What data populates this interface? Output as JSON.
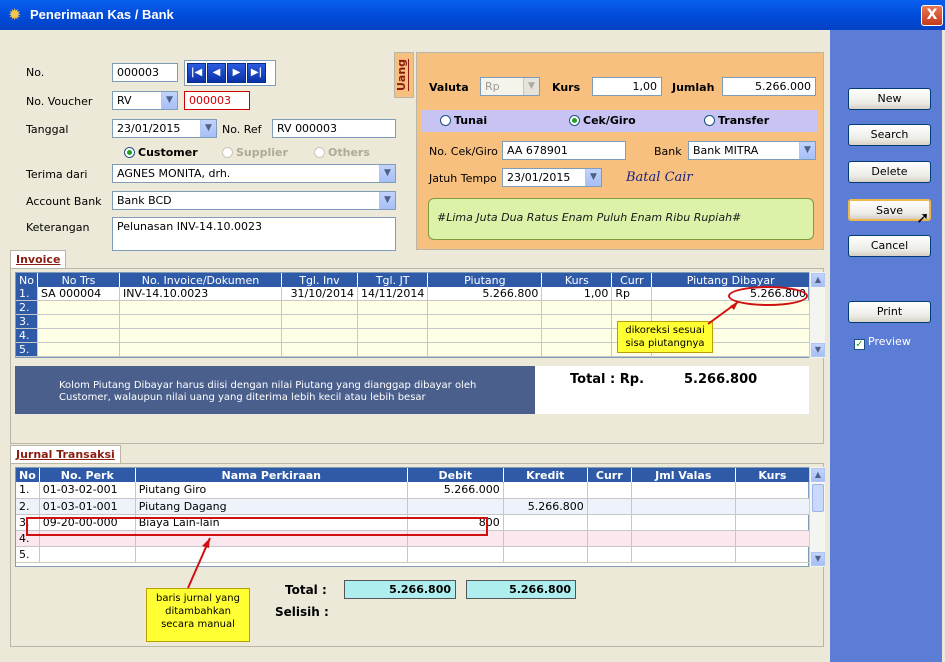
{
  "window": {
    "title": "Penerimaan Kas / Bank",
    "close_glyph": "X"
  },
  "form": {
    "no_label": "No.",
    "no_value": "000003",
    "voucher_label": "No. Voucher",
    "voucher_type": "RV",
    "voucher_no": "000003",
    "tanggal_label": "Tanggal",
    "tanggal_value": "23/01/2015",
    "noref_label": "No. Ref",
    "noref_value": "RV 000003",
    "radio_customer": "Customer",
    "radio_supplier": "Supplier",
    "radio_others": "Others",
    "terima_label": "Terima dari",
    "terima_value": "AGNES MONITA, drh.",
    "account_label": "Account Bank",
    "account_value": "Bank BCD",
    "ket_label": "Keterangan",
    "ket_value": "Pelunasan INV-14.10.0023"
  },
  "uang": {
    "tab": "Uang",
    "valuta_label": "Valuta",
    "valuta_value": "Rp",
    "kurs_label": "Kurs",
    "kurs_value": "1,00",
    "jumlah_label": "Jumlah",
    "jumlah_value": "5.266.000",
    "tunai": "Tunai",
    "cekgiro": "Cek/Giro",
    "transfer": "Transfer",
    "nocek_label": "No. Cek/Giro",
    "nocek_value": "AA 678901",
    "bank_label": "Bank",
    "bank_value": "Bank MITRA",
    "jatuh_label": "Jatuh Tempo",
    "jatuh_value": "23/01/2015",
    "batal": "Batal Cair",
    "terbilang": "#Lima Juta Dua Ratus Enam Puluh Enam Ribu Rupiah#"
  },
  "invoice": {
    "tab": "Invoice",
    "headers": [
      "No",
      "No Trs",
      "No. Invoice/Dokumen",
      "Tgl. Inv",
      "Tgl. JT",
      "Piutang",
      "Kurs",
      "Curr",
      "Piutang Dibayar"
    ],
    "rows": [
      {
        "no": "1.",
        "trs": "SA  000004",
        "inv": "INV-14.10.0023",
        "tinv": "31/10/2014",
        "tjt": "14/11/2014",
        "piutang": "5.266.800",
        "kurs": "1,00",
        "curr": "Rp",
        "dibayar": "5.266.800"
      },
      {
        "no": "2.",
        "trs": "",
        "inv": "",
        "tinv": "",
        "tjt": "",
        "piutang": "",
        "kurs": "",
        "curr": "",
        "dibayar": ""
      },
      {
        "no": "3.",
        "trs": "",
        "inv": "",
        "tinv": "",
        "tjt": "",
        "piutang": "",
        "kurs": "",
        "curr": "",
        "dibayar": ""
      },
      {
        "no": "4.",
        "trs": "",
        "inv": "",
        "tinv": "",
        "tjt": "",
        "piutang": "",
        "kurs": "",
        "curr": "",
        "dibayar": ""
      },
      {
        "no": "5.",
        "trs": "",
        "inv": "",
        "tinv": "",
        "tjt": "",
        "piutang": "",
        "kurs": "",
        "curr": "",
        "dibayar": ""
      }
    ],
    "note": "Kolom Piutang Dibayar harus diisi dengan nilai Piutang yang dianggap dibayar oleh Customer, walaupun nilai uang yang diterima lebih kecil atau lebih besar",
    "total_label": "Total : Rp.",
    "total_value": "5.266.800",
    "callout": "dikoreksi sesuai sisa piutangnya"
  },
  "jurnal": {
    "tab": "Jurnal Transaksi",
    "headers": [
      "No",
      "No. Perk",
      "Nama Perkiraan",
      "Debit",
      "Kredit",
      "Curr",
      "Jml Valas",
      "Kurs"
    ],
    "rows": [
      {
        "no": "1.",
        "perk": "01-03-02-001",
        "nama": "Piutang Giro",
        "debit": "5.266.000",
        "kredit": ""
      },
      {
        "no": "2.",
        "perk": "01-03-01-001",
        "nama": "Piutang Dagang",
        "debit": "",
        "kredit": "5.266.800"
      },
      {
        "no": "3.",
        "perk": "09-20-00-000",
        "nama": "Biaya Lain-lain",
        "debit": "800",
        "kredit": ""
      },
      {
        "no": "4.",
        "perk": "",
        "nama": "",
        "debit": "",
        "kredit": ""
      },
      {
        "no": "5.",
        "perk": "",
        "nama": "",
        "debit": "",
        "kredit": ""
      }
    ],
    "total_label": "Total :",
    "total_debit": "5.266.800",
    "total_kredit": "5.266.800",
    "selisih_label": "Selisih :",
    "callout": "baris jurnal yang ditambahkan secara manual"
  },
  "buttons": {
    "new": "New",
    "search": "Search",
    "delete": "Delete",
    "save": "Save",
    "cancel": "Cancel",
    "print": "Print",
    "preview": "Preview"
  }
}
